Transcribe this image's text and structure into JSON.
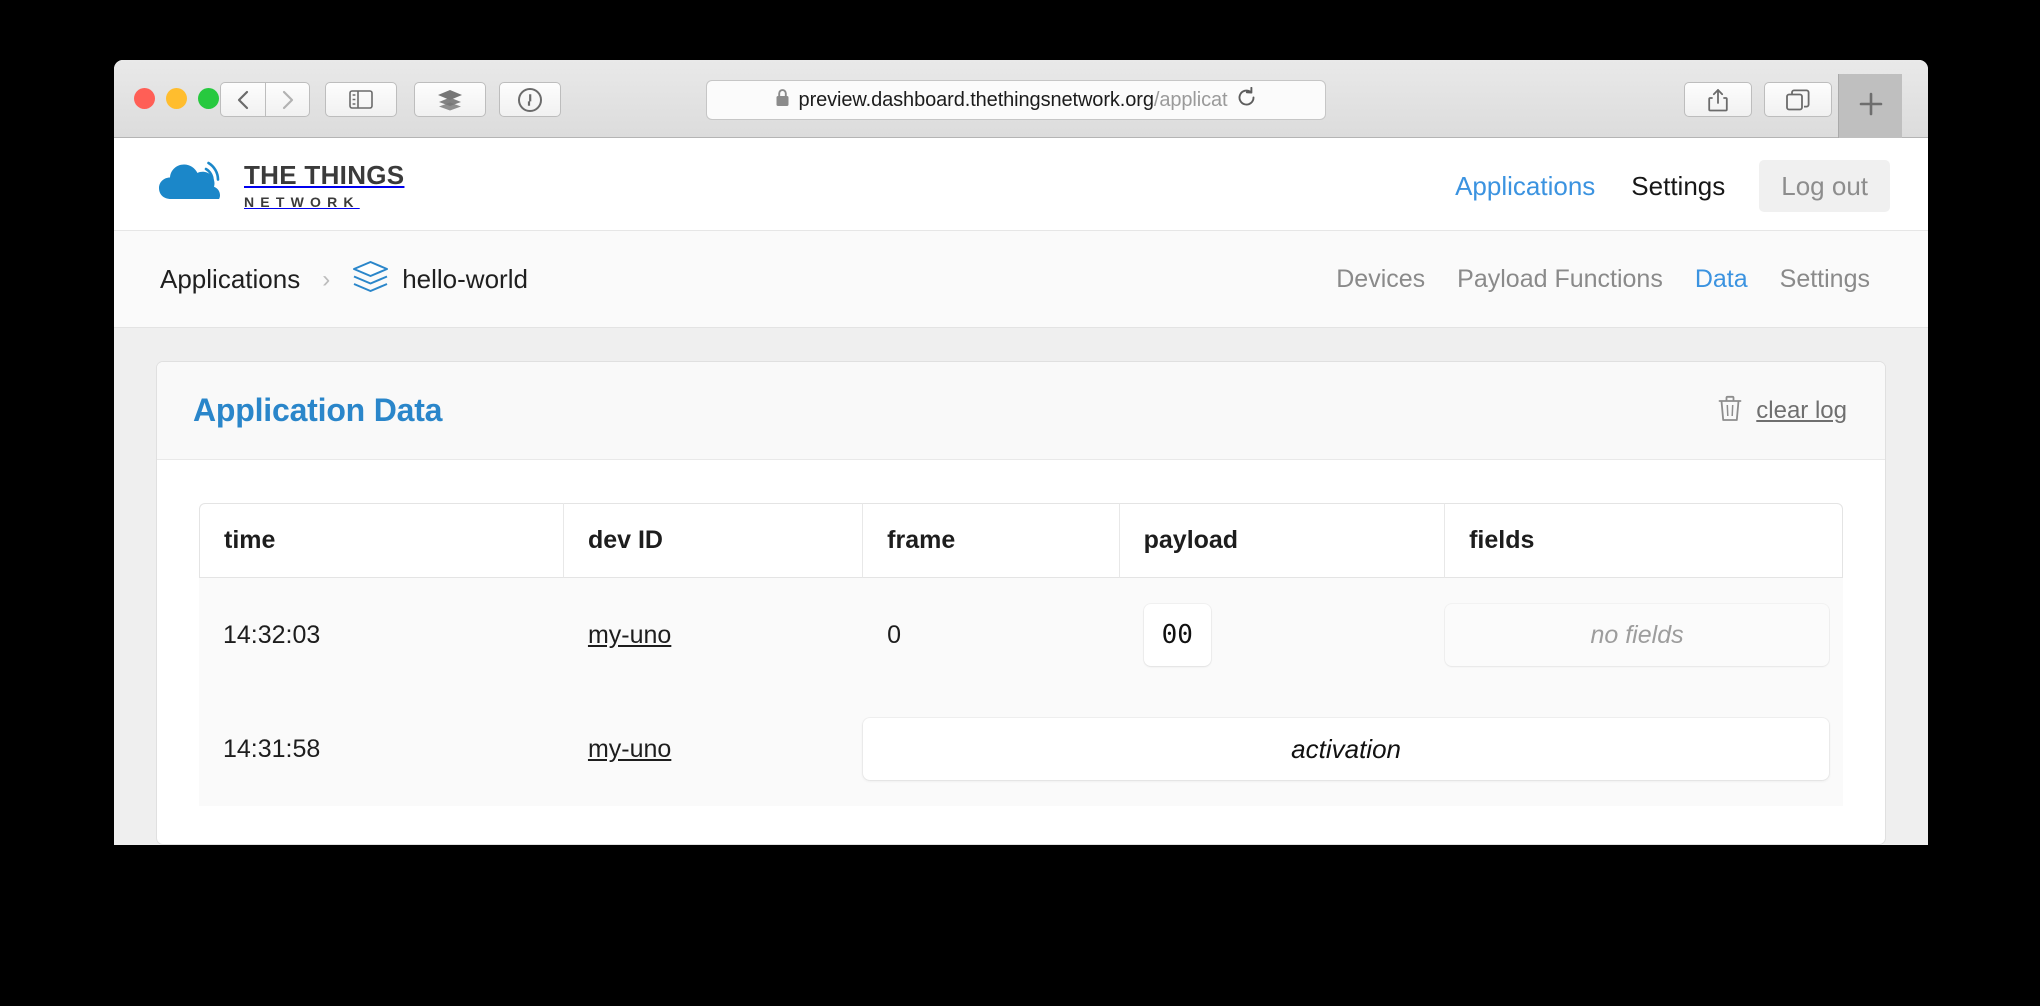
{
  "browser": {
    "url_visible": "preview.dashboard.thethingsnetwork.org",
    "url_dim": "/applicat",
    "lock_icon": "lock-icon",
    "reload_icon": "reload-icon",
    "back_icon": "chevron-left-icon",
    "forward_icon": "chevron-right-icon",
    "sidebar_icon": "sidebar-icon",
    "layers_icon": "layers-icon",
    "password_icon": "onepassword-icon",
    "share_icon": "share-icon",
    "tabs_icon": "tab-overview-icon",
    "new_tab_icon": "plus-icon"
  },
  "header": {
    "logo": {
      "icon": "ttn-cloud-logo-icon",
      "line1": "THE THINGS",
      "line2": "NETWORK"
    },
    "nav": [
      {
        "label": "Applications",
        "active": true
      },
      {
        "label": "Settings",
        "active": false
      }
    ],
    "logout_label": "Log out"
  },
  "subnav": {
    "breadcrumb": {
      "root_label": "Applications",
      "separator": "›",
      "app_icon": "app-layers-icon",
      "app_label": "hello-world"
    },
    "tabs": [
      {
        "label": "Devices",
        "active": false
      },
      {
        "label": "Payload Functions",
        "active": false
      },
      {
        "label": "Data",
        "active": true
      },
      {
        "label": "Settings",
        "active": false
      }
    ]
  },
  "card": {
    "title": "Application Data",
    "clear_log": {
      "icon": "trash-icon",
      "label": "clear log"
    }
  },
  "table": {
    "columns": [
      "time",
      "dev ID",
      "frame",
      "payload",
      "fields"
    ],
    "rows": [
      {
        "type": "uplink",
        "time": "14:32:03",
        "dev_id": "my-uno",
        "frame": "0",
        "payload": "00",
        "fields": "no fields"
      },
      {
        "type": "activation",
        "time": "14:31:58",
        "dev_id": "my-uno",
        "message": "activation"
      }
    ]
  },
  "colors": {
    "brand_blue": "#3b93e0",
    "title_blue": "#2a86ca",
    "tab_underline": "#6cb4ea",
    "page_bg": "#efefef",
    "logo_cloud": "#1b87c9"
  }
}
